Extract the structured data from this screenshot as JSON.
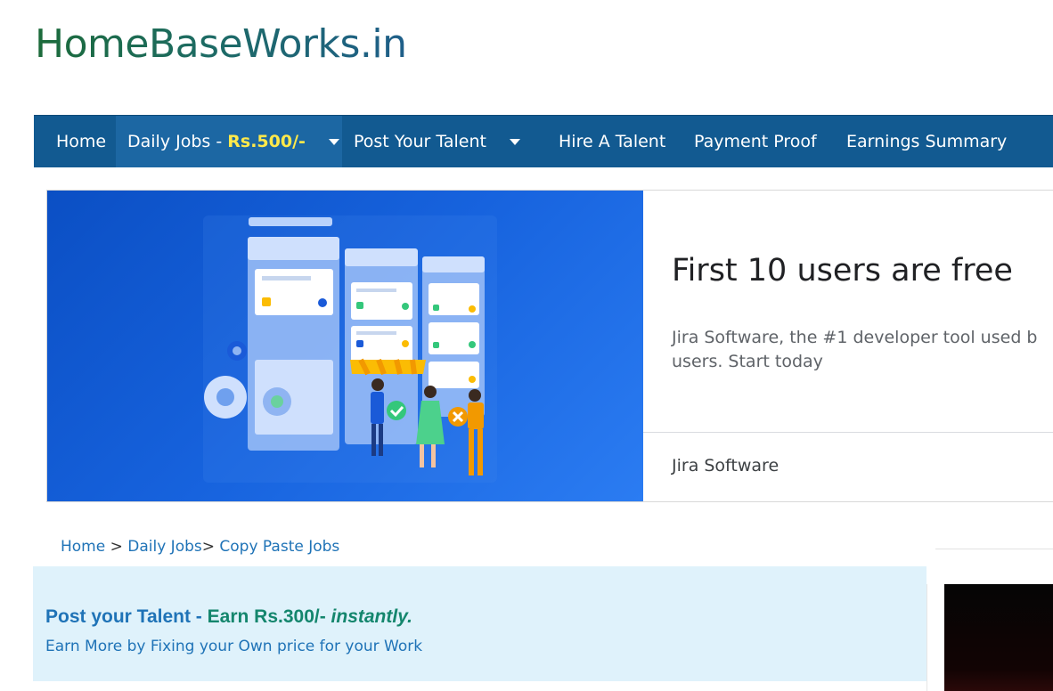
{
  "site": {
    "title": "HomeBaseWorks.in"
  },
  "nav": {
    "items": [
      {
        "label": "Home"
      },
      {
        "label": "Daily Jobs - ",
        "highlight": "Rs.500/-",
        "has_dropdown": true,
        "active": true
      },
      {
        "label": "Post Your Talent",
        "has_dropdown": true
      },
      {
        "label": "Hire A Talent"
      },
      {
        "label": "Payment Proof"
      },
      {
        "label": "Earnings Summary"
      }
    ]
  },
  "ad": {
    "headline": "First 10 users are free",
    "description": "Jira Software, the #1 developer tool used b users. Start today",
    "advertiser": "Jira Software"
  },
  "breadcrumb": {
    "home": "Home",
    "sep1": ">",
    "daily_jobs": "Daily Jobs",
    "sep2": ">",
    "current": "Copy Paste Jobs"
  },
  "promo": {
    "title_part1": "Post your Talent - ",
    "title_part2": "Earn Rs.300/- ",
    "title_part3": "instantly.",
    "subtitle": "Earn More by Fixing your Own price for your Work"
  },
  "colors": {
    "nav_bg": "#125a91",
    "nav_active": "#1c67a3",
    "highlight": "#ffe94a",
    "link": "#1f73b7",
    "promo_bg": "#dff2fb",
    "ad_blue": "#1763de"
  }
}
